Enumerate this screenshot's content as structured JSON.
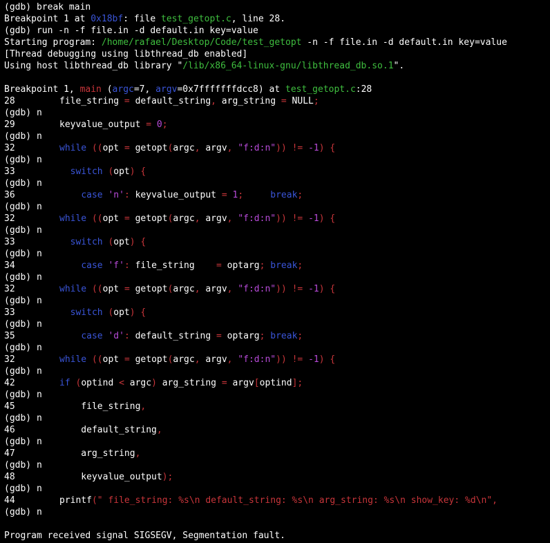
{
  "window": {
    "title": "gdb terminal session"
  },
  "colors": {
    "background": "#000000",
    "text": "#ffffff",
    "keyword": "#3a55d8",
    "path": "#3fbf3f",
    "number": "#b84bd9",
    "punct": "#c8353a"
  },
  "terminal": {
    "lines": [
      {
        "segments": [
          {
            "t": "(gdb) break main",
            "c": "white"
          }
        ]
      },
      {
        "segments": [
          {
            "t": "Breakpoint 1 at ",
            "c": "white"
          },
          {
            "t": "0x18bf",
            "c": "blue"
          },
          {
            "t": ": file ",
            "c": "white"
          },
          {
            "t": "test_getopt.c",
            "c": "green"
          },
          {
            "t": ", line 28.",
            "c": "white"
          }
        ]
      },
      {
        "segments": [
          {
            "t": "(gdb) run -n -f file.in -d default.in key=value",
            "c": "white"
          }
        ]
      },
      {
        "segments": [
          {
            "t": "Starting program: ",
            "c": "white"
          },
          {
            "t": "/home/rafael/Desktop/Code/test_getopt",
            "c": "green"
          },
          {
            "t": " -n -f file.in -d default.in key=value",
            "c": "white"
          }
        ]
      },
      {
        "segments": [
          {
            "t": "[Thread debugging using libthread_db enabled]",
            "c": "white"
          }
        ]
      },
      {
        "segments": [
          {
            "t": "Using host libthread_db library \"",
            "c": "white"
          },
          {
            "t": "/lib/x86_64-linux-gnu/libthread_db.so.1",
            "c": "green"
          },
          {
            "t": "\".",
            "c": "white"
          }
        ]
      },
      {
        "segments": [
          {
            "t": "",
            "c": "white"
          }
        ]
      },
      {
        "segments": [
          {
            "t": "Breakpoint 1, ",
            "c": "white"
          },
          {
            "t": "main",
            "c": "red"
          },
          {
            "t": " (",
            "c": "white"
          },
          {
            "t": "argc",
            "c": "blue"
          },
          {
            "t": "=7, ",
            "c": "white"
          },
          {
            "t": "argv",
            "c": "blue"
          },
          {
            "t": "=0x7fffffffdcc8) at ",
            "c": "white"
          },
          {
            "t": "test_getopt.c",
            "c": "green"
          },
          {
            "t": ":28",
            "c": "white"
          }
        ]
      },
      {
        "ln": "28",
        "segments": [
          {
            "t": "file_string ",
            "c": "white"
          },
          {
            "t": "=",
            "c": "red"
          },
          {
            "t": " default_string",
            "c": "white"
          },
          {
            "t": ",",
            "c": "red"
          },
          {
            "t": " arg_string ",
            "c": "white"
          },
          {
            "t": "=",
            "c": "red"
          },
          {
            "t": " NULL",
            "c": "white"
          },
          {
            "t": ";",
            "c": "red"
          }
        ]
      },
      {
        "segments": [
          {
            "t": "(gdb) n",
            "c": "white"
          }
        ]
      },
      {
        "ln": "29",
        "segments": [
          {
            "t": "keyvalue_output ",
            "c": "white"
          },
          {
            "t": "=",
            "c": "red"
          },
          {
            "t": " ",
            "c": "white"
          },
          {
            "t": "0",
            "c": "purple"
          },
          {
            "t": ";",
            "c": "red"
          }
        ]
      },
      {
        "segments": [
          {
            "t": "(gdb) n",
            "c": "white"
          }
        ]
      },
      {
        "ln": "32",
        "segments": [
          {
            "t": "while",
            "c": "blue"
          },
          {
            "t": " ((",
            "c": "red"
          },
          {
            "t": "opt ",
            "c": "white"
          },
          {
            "t": "=",
            "c": "red"
          },
          {
            "t": " getopt",
            "c": "white"
          },
          {
            "t": "(",
            "c": "red"
          },
          {
            "t": "argc",
            "c": "white"
          },
          {
            "t": ",",
            "c": "red"
          },
          {
            "t": " argv",
            "c": "white"
          },
          {
            "t": ",",
            "c": "red"
          },
          {
            "t": " ",
            "c": "white"
          },
          {
            "t": "\"f:d:n\"",
            "c": "purple"
          },
          {
            "t": "))",
            "c": "red"
          },
          {
            "t": " ",
            "c": "white"
          },
          {
            "t": "!=",
            "c": "red"
          },
          {
            "t": " ",
            "c": "white"
          },
          {
            "t": "-1",
            "c": "purple"
          },
          {
            "t": ")",
            "c": "red"
          },
          {
            "t": " ",
            "c": "white"
          },
          {
            "t": "{",
            "c": "red"
          }
        ]
      },
      {
        "segments": [
          {
            "t": "(gdb) n",
            "c": "white"
          }
        ]
      },
      {
        "ln": "33",
        "segments": [
          {
            "t": "  ",
            "c": "white"
          },
          {
            "t": "switch",
            "c": "blue"
          },
          {
            "t": " (",
            "c": "red"
          },
          {
            "t": "opt",
            "c": "white"
          },
          {
            "t": ")",
            "c": "red"
          },
          {
            "t": " ",
            "c": "white"
          },
          {
            "t": "{",
            "c": "red"
          }
        ]
      },
      {
        "segments": [
          {
            "t": "(gdb) n",
            "c": "white"
          }
        ]
      },
      {
        "ln": "36",
        "segments": [
          {
            "t": "    ",
            "c": "white"
          },
          {
            "t": "case",
            "c": "blue"
          },
          {
            "t": " ",
            "c": "white"
          },
          {
            "t": "'n'",
            "c": "purple"
          },
          {
            "t": ":",
            "c": "red"
          },
          {
            "t": " keyvalue_output ",
            "c": "white"
          },
          {
            "t": "=",
            "c": "red"
          },
          {
            "t": " ",
            "c": "white"
          },
          {
            "t": "1",
            "c": "purple"
          },
          {
            "t": ";",
            "c": "red"
          },
          {
            "t": "     ",
            "c": "white"
          },
          {
            "t": "break",
            "c": "blue"
          },
          {
            "t": ";",
            "c": "red"
          }
        ]
      },
      {
        "segments": [
          {
            "t": "(gdb) n",
            "c": "white"
          }
        ]
      },
      {
        "ln": "32",
        "segments": [
          {
            "t": "while",
            "c": "blue"
          },
          {
            "t": " ((",
            "c": "red"
          },
          {
            "t": "opt ",
            "c": "white"
          },
          {
            "t": "=",
            "c": "red"
          },
          {
            "t": " getopt",
            "c": "white"
          },
          {
            "t": "(",
            "c": "red"
          },
          {
            "t": "argc",
            "c": "white"
          },
          {
            "t": ",",
            "c": "red"
          },
          {
            "t": " argv",
            "c": "white"
          },
          {
            "t": ",",
            "c": "red"
          },
          {
            "t": " ",
            "c": "white"
          },
          {
            "t": "\"f:d:n\"",
            "c": "purple"
          },
          {
            "t": "))",
            "c": "red"
          },
          {
            "t": " ",
            "c": "white"
          },
          {
            "t": "!=",
            "c": "red"
          },
          {
            "t": " ",
            "c": "white"
          },
          {
            "t": "-1",
            "c": "purple"
          },
          {
            "t": ")",
            "c": "red"
          },
          {
            "t": " ",
            "c": "white"
          },
          {
            "t": "{",
            "c": "red"
          }
        ]
      },
      {
        "segments": [
          {
            "t": "(gdb) n",
            "c": "white"
          }
        ]
      },
      {
        "ln": "33",
        "segments": [
          {
            "t": "  ",
            "c": "white"
          },
          {
            "t": "switch",
            "c": "blue"
          },
          {
            "t": " (",
            "c": "red"
          },
          {
            "t": "opt",
            "c": "white"
          },
          {
            "t": ")",
            "c": "red"
          },
          {
            "t": " ",
            "c": "white"
          },
          {
            "t": "{",
            "c": "red"
          }
        ]
      },
      {
        "segments": [
          {
            "t": "(gdb) n",
            "c": "white"
          }
        ]
      },
      {
        "ln": "34",
        "segments": [
          {
            "t": "    ",
            "c": "white"
          },
          {
            "t": "case",
            "c": "blue"
          },
          {
            "t": " ",
            "c": "white"
          },
          {
            "t": "'f'",
            "c": "purple"
          },
          {
            "t": ":",
            "c": "red"
          },
          {
            "t": " file_string    ",
            "c": "white"
          },
          {
            "t": "=",
            "c": "red"
          },
          {
            "t": " optarg",
            "c": "white"
          },
          {
            "t": ";",
            "c": "red"
          },
          {
            "t": " ",
            "c": "white"
          },
          {
            "t": "break",
            "c": "blue"
          },
          {
            "t": ";",
            "c": "red"
          }
        ]
      },
      {
        "segments": [
          {
            "t": "(gdb) n",
            "c": "white"
          }
        ]
      },
      {
        "ln": "32",
        "segments": [
          {
            "t": "while",
            "c": "blue"
          },
          {
            "t": " ((",
            "c": "red"
          },
          {
            "t": "opt ",
            "c": "white"
          },
          {
            "t": "=",
            "c": "red"
          },
          {
            "t": " getopt",
            "c": "white"
          },
          {
            "t": "(",
            "c": "red"
          },
          {
            "t": "argc",
            "c": "white"
          },
          {
            "t": ",",
            "c": "red"
          },
          {
            "t": " argv",
            "c": "white"
          },
          {
            "t": ",",
            "c": "red"
          },
          {
            "t": " ",
            "c": "white"
          },
          {
            "t": "\"f:d:n\"",
            "c": "purple"
          },
          {
            "t": "))",
            "c": "red"
          },
          {
            "t": " ",
            "c": "white"
          },
          {
            "t": "!=",
            "c": "red"
          },
          {
            "t": " ",
            "c": "white"
          },
          {
            "t": "-1",
            "c": "purple"
          },
          {
            "t": ")",
            "c": "red"
          },
          {
            "t": " ",
            "c": "white"
          },
          {
            "t": "{",
            "c": "red"
          }
        ]
      },
      {
        "segments": [
          {
            "t": "(gdb) n",
            "c": "white"
          }
        ]
      },
      {
        "ln": "33",
        "segments": [
          {
            "t": "  ",
            "c": "white"
          },
          {
            "t": "switch",
            "c": "blue"
          },
          {
            "t": " (",
            "c": "red"
          },
          {
            "t": "opt",
            "c": "white"
          },
          {
            "t": ")",
            "c": "red"
          },
          {
            "t": " ",
            "c": "white"
          },
          {
            "t": "{",
            "c": "red"
          }
        ]
      },
      {
        "segments": [
          {
            "t": "(gdb) n",
            "c": "white"
          }
        ]
      },
      {
        "ln": "35",
        "segments": [
          {
            "t": "    ",
            "c": "white"
          },
          {
            "t": "case",
            "c": "blue"
          },
          {
            "t": " ",
            "c": "white"
          },
          {
            "t": "'d'",
            "c": "purple"
          },
          {
            "t": ":",
            "c": "red"
          },
          {
            "t": " default_string ",
            "c": "white"
          },
          {
            "t": "=",
            "c": "red"
          },
          {
            "t": " optarg",
            "c": "white"
          },
          {
            "t": ";",
            "c": "red"
          },
          {
            "t": " ",
            "c": "white"
          },
          {
            "t": "break",
            "c": "blue"
          },
          {
            "t": ";",
            "c": "red"
          }
        ]
      },
      {
        "segments": [
          {
            "t": "(gdb) n",
            "c": "white"
          }
        ]
      },
      {
        "ln": "32",
        "segments": [
          {
            "t": "while",
            "c": "blue"
          },
          {
            "t": " ((",
            "c": "red"
          },
          {
            "t": "opt ",
            "c": "white"
          },
          {
            "t": "=",
            "c": "red"
          },
          {
            "t": " getopt",
            "c": "white"
          },
          {
            "t": "(",
            "c": "red"
          },
          {
            "t": "argc",
            "c": "white"
          },
          {
            "t": ",",
            "c": "red"
          },
          {
            "t": " argv",
            "c": "white"
          },
          {
            "t": ",",
            "c": "red"
          },
          {
            "t": " ",
            "c": "white"
          },
          {
            "t": "\"f:d:n\"",
            "c": "purple"
          },
          {
            "t": "))",
            "c": "red"
          },
          {
            "t": " ",
            "c": "white"
          },
          {
            "t": "!=",
            "c": "red"
          },
          {
            "t": " ",
            "c": "white"
          },
          {
            "t": "-1",
            "c": "purple"
          },
          {
            "t": ")",
            "c": "red"
          },
          {
            "t": " ",
            "c": "white"
          },
          {
            "t": "{",
            "c": "red"
          }
        ]
      },
      {
        "segments": [
          {
            "t": "(gdb) n",
            "c": "white"
          }
        ]
      },
      {
        "ln": "42",
        "segments": [
          {
            "t": "if",
            "c": "blue"
          },
          {
            "t": " (",
            "c": "red"
          },
          {
            "t": "optind ",
            "c": "white"
          },
          {
            "t": "<",
            "c": "red"
          },
          {
            "t": " argc",
            "c": "white"
          },
          {
            "t": ")",
            "c": "red"
          },
          {
            "t": " arg_string ",
            "c": "white"
          },
          {
            "t": "=",
            "c": "red"
          },
          {
            "t": " argv",
            "c": "white"
          },
          {
            "t": "[",
            "c": "red"
          },
          {
            "t": "optind",
            "c": "white"
          },
          {
            "t": "];",
            "c": "red"
          }
        ]
      },
      {
        "segments": [
          {
            "t": "(gdb) n",
            "c": "white"
          }
        ]
      },
      {
        "ln": "45",
        "segments": [
          {
            "t": "    file_string",
            "c": "white"
          },
          {
            "t": ",",
            "c": "red"
          }
        ]
      },
      {
        "segments": [
          {
            "t": "(gdb) n",
            "c": "white"
          }
        ]
      },
      {
        "ln": "46",
        "segments": [
          {
            "t": "    default_string",
            "c": "white"
          },
          {
            "t": ",",
            "c": "red"
          }
        ]
      },
      {
        "segments": [
          {
            "t": "(gdb) n",
            "c": "white"
          }
        ]
      },
      {
        "ln": "47",
        "segments": [
          {
            "t": "    arg_string",
            "c": "white"
          },
          {
            "t": ",",
            "c": "red"
          }
        ]
      },
      {
        "segments": [
          {
            "t": "(gdb) n",
            "c": "white"
          }
        ]
      },
      {
        "ln": "48",
        "segments": [
          {
            "t": "    keyvalue_output",
            "c": "white"
          },
          {
            "t": ");",
            "c": "red"
          }
        ]
      },
      {
        "segments": [
          {
            "t": "(gdb) n",
            "c": "white"
          }
        ]
      },
      {
        "ln": "44",
        "segments": [
          {
            "t": "printf",
            "c": "white"
          },
          {
            "t": "(",
            "c": "red"
          },
          {
            "t": "\" file_string: %s\\n default_string: %s\\n arg_string: %s\\n show_key: %d\\n\"",
            "c": "red"
          },
          {
            "t": ",",
            "c": "red"
          }
        ]
      },
      {
        "segments": [
          {
            "t": "(gdb) n",
            "c": "white"
          }
        ]
      },
      {
        "segments": [
          {
            "t": "",
            "c": "white"
          }
        ]
      },
      {
        "segments": [
          {
            "t": "Program received signal SIGSEGV, Segmentation fault.",
            "c": "white"
          }
        ]
      }
    ]
  }
}
